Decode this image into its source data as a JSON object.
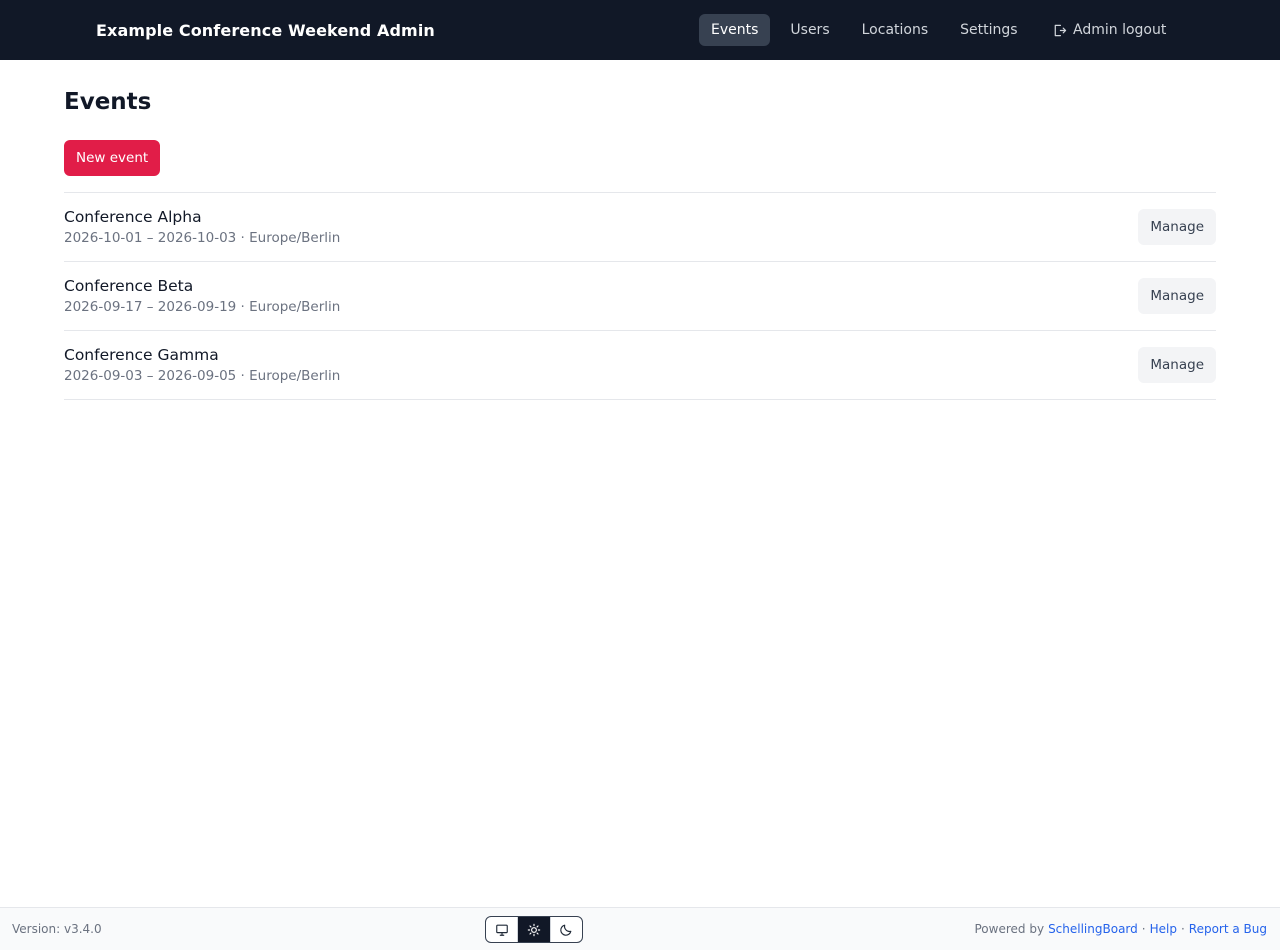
{
  "header": {
    "brand": "Example Conference Weekend Admin",
    "nav": [
      {
        "label": "Events",
        "active": true
      },
      {
        "label": "Users",
        "active": false
      },
      {
        "label": "Locations",
        "active": false
      },
      {
        "label": "Settings",
        "active": false
      }
    ],
    "logout_label": "Admin logout"
  },
  "main": {
    "title": "Events",
    "new_event_label": "New event",
    "events": [
      {
        "name": "Conference Alpha",
        "meta": "2026-10-01 – 2026-10-03 · Europe/Berlin",
        "action": "Manage"
      },
      {
        "name": "Conference Beta",
        "meta": "2026-09-17 – 2026-09-19 · Europe/Berlin",
        "action": "Manage"
      },
      {
        "name": "Conference Gamma",
        "meta": "2026-09-03 – 2026-09-05 · Europe/Berlin",
        "action": "Manage"
      }
    ]
  },
  "footer": {
    "version": "Version: v3.4.0",
    "theme_options": [
      "monitor-icon",
      "sun-icon",
      "moon-icon"
    ],
    "active_theme": "sun-icon",
    "powered_by": "Powered by",
    "powered_link": "SchellingBoard",
    "separator": "·",
    "help": "Help",
    "report_bug": "Report a Bug"
  },
  "colors": {
    "navbar": "#111827",
    "accent": "#e11d48",
    "link": "#2563eb"
  }
}
